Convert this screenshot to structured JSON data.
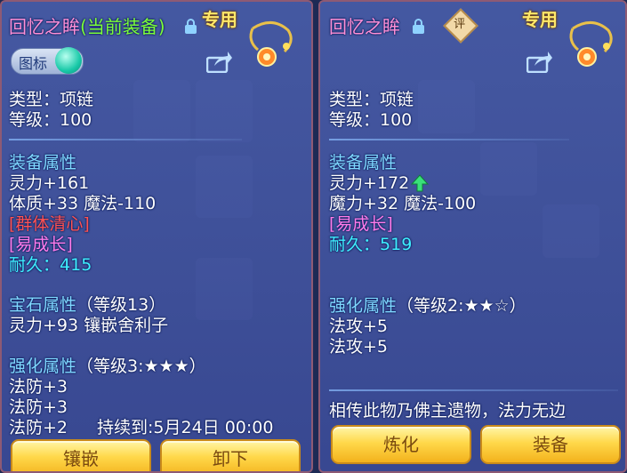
{
  "left": {
    "title_main": "回忆之眸",
    "title_tag": "(当前装备)",
    "exclusive": "专用",
    "toggle_label": "图标",
    "type_line": "类型：项链",
    "level_line": "等级：100",
    "equip_attr_header": "装备属性",
    "stat1": "灵力+161",
    "stat2": "体质+33 魔法-110",
    "special1": "[群体清心]",
    "special2": "[易成长]",
    "durability_label": "耐久：",
    "durability_value": "415",
    "gem_header": "宝石属性",
    "gem_level": "（等级13）",
    "gem_stat": "灵力+93 镶嵌舍利子",
    "enhance_header": "强化属性",
    "enhance_level": "（等级3:★★★）",
    "enh1": "法防+3",
    "enh2": "法防+3",
    "enh3": "法防+2",
    "duration": "持续到:5月24日 00:00",
    "btn_inlay": "镶嵌",
    "btn_unequip": "卸下"
  },
  "right": {
    "title_main": "回忆之眸",
    "badge": "评",
    "exclusive": "专用",
    "type_line": "类型：项链",
    "level_line": "等级：100",
    "equip_attr_header": "装备属性",
    "stat1": "灵力+172",
    "stat2": "魔力+32 魔法-100",
    "special1": "[易成长]",
    "durability_label": "耐久：",
    "durability_value": "519",
    "enhance_header": "强化属性",
    "enhance_level": "（等级2:★★☆）",
    "enh1": "法攻+5",
    "enh2": "法攻+5",
    "lore": "相传此物乃佛主遗物，法力无边",
    "btn_refine": "炼化",
    "btn_equip": "装备"
  },
  "colors": {
    "title": "#ff8fd6",
    "equipped_tag": "#7cff3a",
    "section_header": "#7fd8ff",
    "special_red": "#ff5252",
    "special_pink": "#ff7bea",
    "durability": "#3ff0ff",
    "button_gold": "#ffd84a"
  },
  "icons": [
    "lock-icon",
    "share-icon",
    "necklace-emblem-icon",
    "rating-badge-icon",
    "stat-up-arrow-icon"
  ]
}
